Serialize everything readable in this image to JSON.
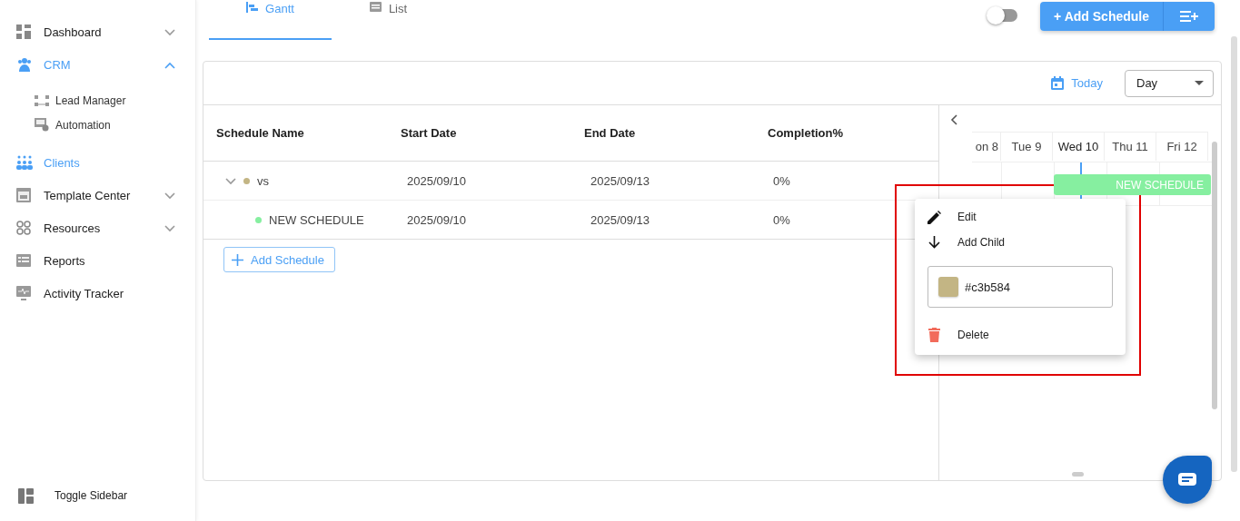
{
  "sidebar": {
    "items": [
      {
        "label": "Dashboard",
        "kind": "group",
        "expanded": false,
        "active": false
      },
      {
        "label": "CRM",
        "kind": "group",
        "expanded": true,
        "active": true,
        "children": [
          {
            "label": "Lead Manager"
          },
          {
            "label": "Automation"
          }
        ]
      },
      {
        "label": "Clients",
        "kind": "link",
        "active": true
      },
      {
        "label": "Template Center",
        "kind": "group",
        "expanded": false,
        "active": false
      },
      {
        "label": "Resources",
        "kind": "group",
        "expanded": false,
        "active": false
      },
      {
        "label": "Reports",
        "kind": "link",
        "active": false
      },
      {
        "label": "Activity Tracker",
        "kind": "link",
        "active": false
      }
    ],
    "footer": {
      "label": "Toggle Sidebar"
    }
  },
  "tabs": [
    {
      "label": "Gantt",
      "selected": true
    },
    {
      "label": "List",
      "selected": false
    }
  ],
  "toggle": {
    "on": false
  },
  "add_button": {
    "label": "+ Add Schedule"
  },
  "toolbar": {
    "today": "Today",
    "view": "Day"
  },
  "table": {
    "columns": [
      "Schedule Name",
      "Start Date",
      "End Date",
      "Completion%"
    ],
    "rows": [
      {
        "name": "vs",
        "color": "#c3b584",
        "start": "2025/09/10",
        "end": "2025/09/13",
        "completion": "0%",
        "expanded": true,
        "children": [
          {
            "name": "NEW SCHEDULE",
            "color": "#86efa0",
            "start": "2025/09/10",
            "end": "2025/09/13",
            "completion": "0%"
          }
        ]
      }
    ],
    "add_label": "Add Schedule"
  },
  "gantt": {
    "days": [
      {
        "label": "on 8",
        "today": false
      },
      {
        "label": "Tue 9",
        "today": false
      },
      {
        "label": "Wed 10",
        "today": true
      },
      {
        "label": "Thu 11",
        "today": false
      },
      {
        "label": "Fri 12",
        "today": false
      }
    ],
    "bars": [
      {
        "label": "NEW SCHEDULE",
        "color": "#86efa0"
      }
    ]
  },
  "menu": {
    "items": [
      {
        "kind": "action",
        "label": "Edit"
      },
      {
        "kind": "add",
        "label": "Add Child"
      },
      {
        "kind": "color",
        "color": "#c3b584",
        "value": "#c3b584"
      },
      {
        "kind": "danger",
        "label": "Delete"
      }
    ]
  }
}
